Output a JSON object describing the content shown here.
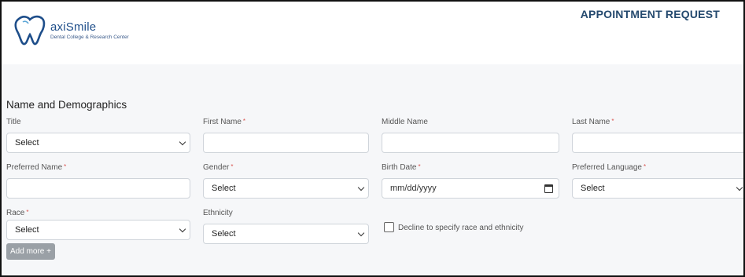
{
  "brand": {
    "name": "axiSmile",
    "tagline": "Dental College & Research Center"
  },
  "page_title": "APPOINTMENT REQUEST",
  "section_title": "Name and Demographics",
  "fields": {
    "title": {
      "label": "Title",
      "value": "Select"
    },
    "first_name": {
      "label": "First Name",
      "value": ""
    },
    "middle_name": {
      "label": "Middle Name",
      "value": ""
    },
    "last_name": {
      "label": "Last Name",
      "value": ""
    },
    "preferred_name": {
      "label": "Preferred Name",
      "value": ""
    },
    "gender": {
      "label": "Gender",
      "value": "Select"
    },
    "birth_date": {
      "label": "Birth Date",
      "placeholder": "mm/dd/yyyy"
    },
    "preferred_language": {
      "label": "Preferred Language",
      "value": "Select"
    },
    "race": {
      "label": "Race",
      "value": "Select"
    },
    "ethnicity": {
      "label": "Ethnicity",
      "value": "Select"
    },
    "decline": {
      "label": "Decline to specify race and ethnicity",
      "checked": false
    }
  },
  "required_mark": "*",
  "add_more_button": "Add more +",
  "colors": {
    "brand_blue": "#1e4e8a",
    "title_blue": "#24496e",
    "required_red": "#d9534f",
    "button_gray": "#9aa0a6"
  }
}
